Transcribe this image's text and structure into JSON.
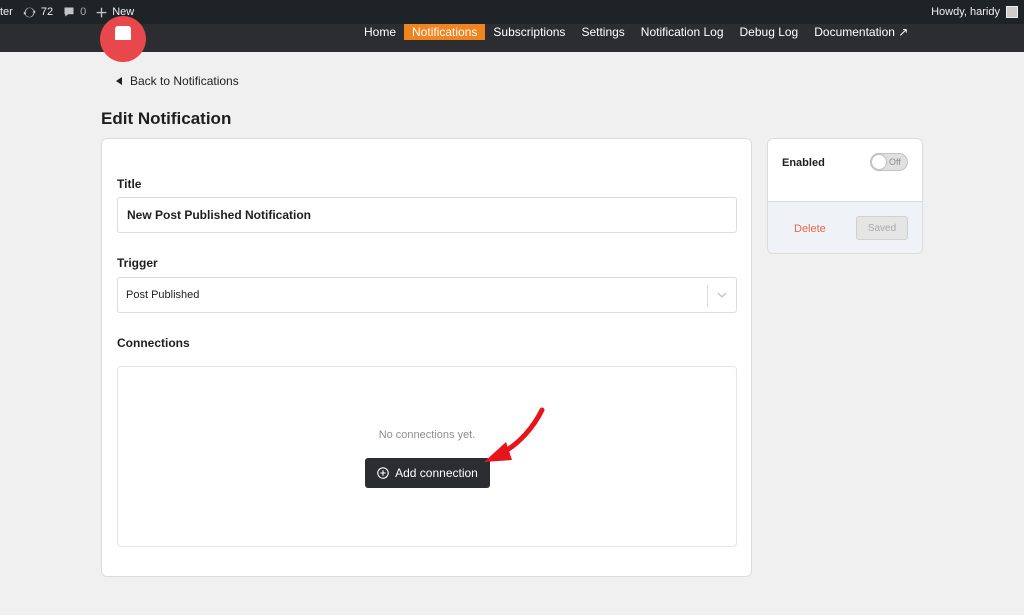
{
  "adminbar": {
    "site_fragment": "ter",
    "updates_count": "72",
    "comments_count": "0",
    "new_label": "New",
    "howdy": "Howdy, haridy"
  },
  "nav": {
    "items": [
      {
        "label": "Home"
      },
      {
        "label": "Notifications",
        "active": true
      },
      {
        "label": "Subscriptions"
      },
      {
        "label": "Settings"
      },
      {
        "label": "Notification Log"
      },
      {
        "label": "Debug Log"
      },
      {
        "label": "Documentation ↗"
      }
    ]
  },
  "page": {
    "back_label": "Back to Notifications",
    "title": "Edit Notification"
  },
  "form": {
    "title_label": "Title",
    "title_value": "New Post Published Notification",
    "trigger_label": "Trigger",
    "trigger_value": "Post Published",
    "connections_label": "Connections",
    "empty_text": "No connections yet.",
    "add_connection_label": "Add connection"
  },
  "sidebar": {
    "enabled_label": "Enabled",
    "toggle_text": "Off",
    "delete_label": "Delete",
    "saved_label": "Saved"
  },
  "colors": {
    "accent": "#f08421",
    "brand": "#e8474c",
    "annotation_arrow": "#e8141b",
    "dark_button": "#2b2d31"
  }
}
